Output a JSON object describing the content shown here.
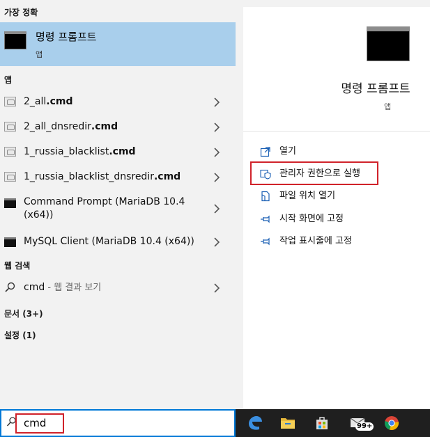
{
  "left": {
    "best_match_header": "가장 정확",
    "best_match": {
      "title": "명령 프롬프트",
      "subtitle": "앱",
      "icon": "command-prompt-icon"
    },
    "apps_header": "앱",
    "apps": [
      {
        "name": "2_all",
        "ext": ".cmd",
        "icon": "cmd-file-icon"
      },
      {
        "name": "2_all_dnsredir",
        "ext": ".cmd",
        "icon": "cmd-file-icon"
      },
      {
        "name": "1_russia_blacklist",
        "ext": ".cmd",
        "icon": "cmd-file-icon"
      },
      {
        "name": "1_russia_blacklist_dnsredir",
        "ext": ".cmd",
        "icon": "cmd-file-icon"
      },
      {
        "name": "Command Prompt (MariaDB 10.4",
        "name2": "(x64))",
        "icon": "console-icon"
      },
      {
        "name": "MySQL Client (MariaDB 10.4 (x64))",
        "icon": "console-icon"
      }
    ],
    "web_header": "웹 검색",
    "web_result": {
      "query": "cmd",
      "suffix": " - 웹 결과 보기",
      "icon": "search-icon"
    },
    "docs": "문서 (3+)",
    "settings": "설정 (1)"
  },
  "search": {
    "value": "cmd"
  },
  "taskbar": [
    "edge-icon",
    "file-explorer-icon",
    "store-icon",
    "mail-icon",
    "chrome-icon"
  ],
  "taskbar_badge": "99+",
  "right": {
    "title": "명령 프롬프트",
    "subtitle": "앱",
    "actions": [
      {
        "label": "열기",
        "icon": "open-icon"
      },
      {
        "label": "관리자 권한으로 실행",
        "icon": "shield-icon"
      },
      {
        "label": "파일 위치 열기",
        "icon": "file-location-icon"
      },
      {
        "label": "시작 화면에 고정",
        "icon": "pin-icon"
      },
      {
        "label": "작업 표시줄에 고정",
        "icon": "pin-icon"
      }
    ]
  },
  "colors": {
    "selection": "#a9cfec",
    "highlight_box": "#d0222a",
    "accent": "#0078d7"
  }
}
